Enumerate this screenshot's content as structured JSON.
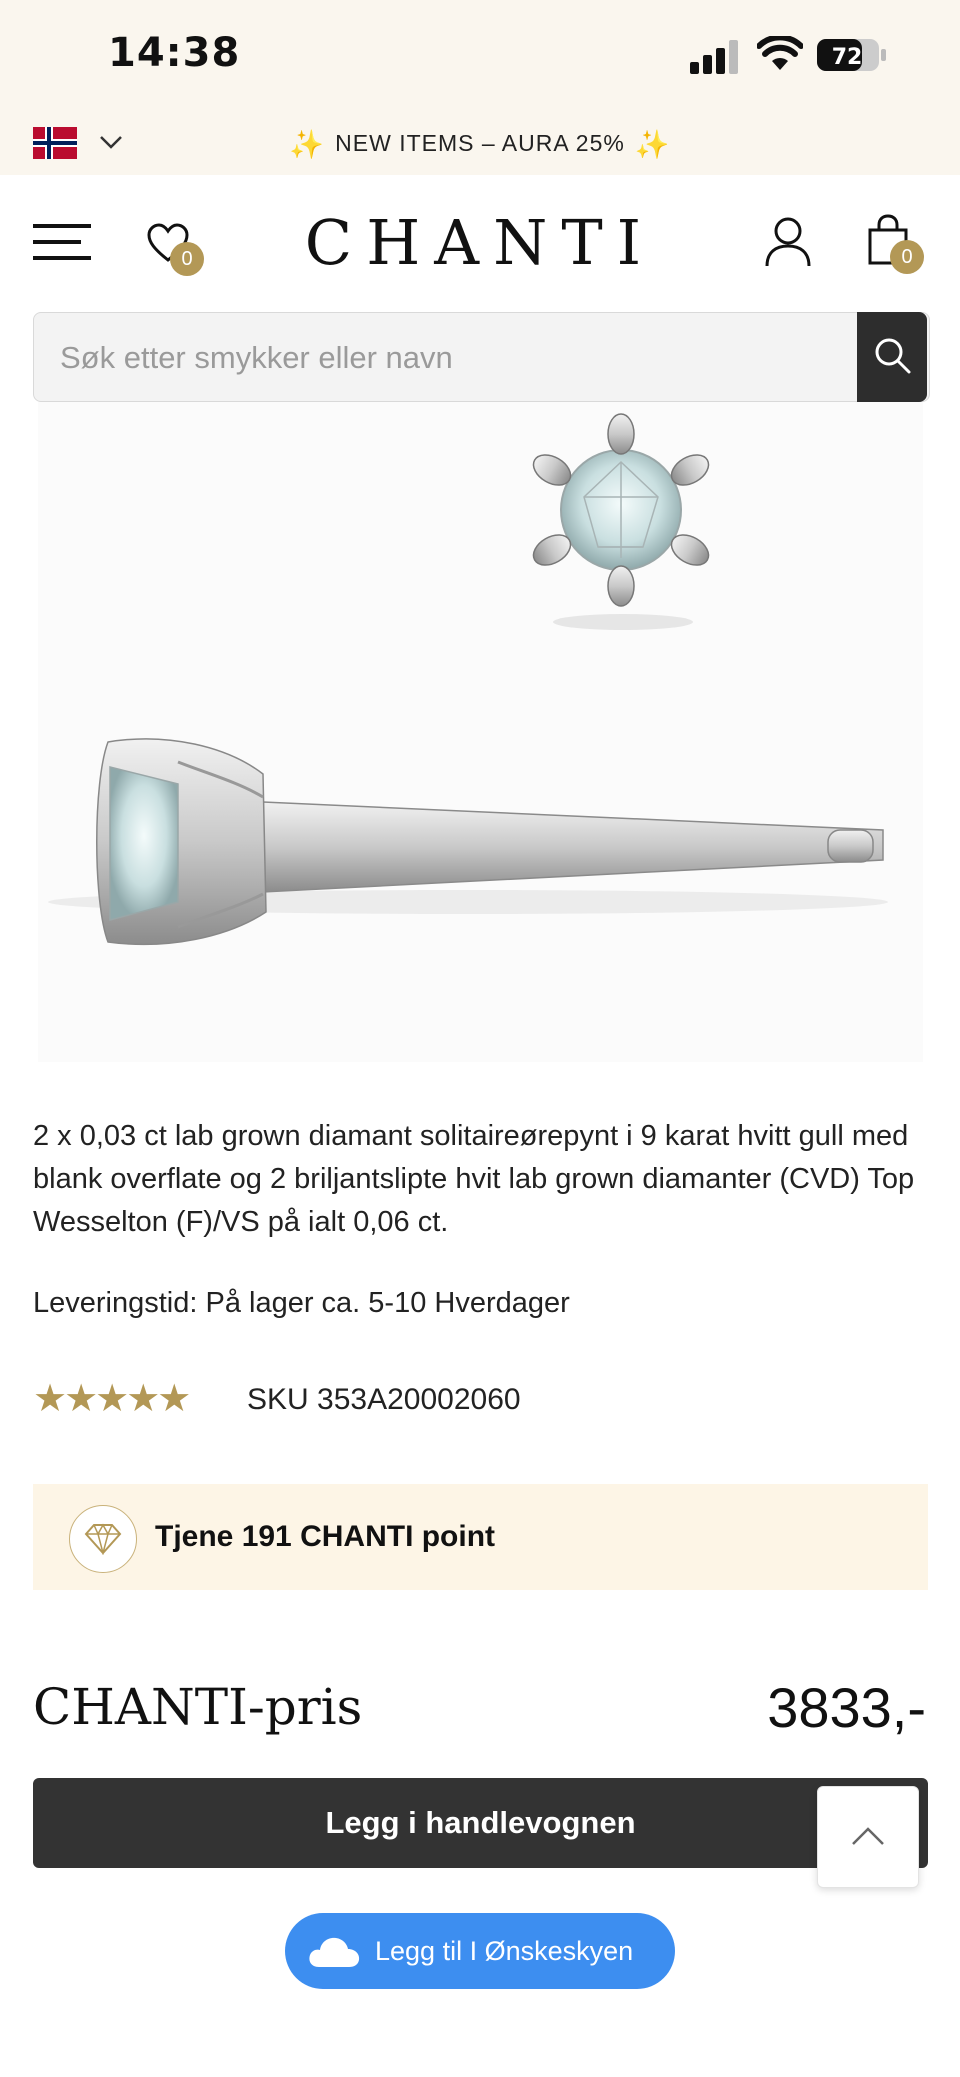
{
  "status_bar": {
    "time": "14:38",
    "battery": "72"
  },
  "promo_bar": {
    "text": "NEW ITEMS – AURA 25%"
  },
  "header": {
    "logo": "CHANTI",
    "wishlist_count": "0",
    "cart_count": "0"
  },
  "search": {
    "placeholder": "Søk etter smykker eller navn"
  },
  "product": {
    "description": "2 x 0,03 ct lab grown diamant solitaireørepynt i 9 karat hvitt gull med blank overflate og 2 briljantslipte hvit lab grown diamanter (CVD) Top Wesselton (F)/VS på ialt 0,06 ct.",
    "delivery": "Leveringstid: På lager ca. 5-10 Hverdager",
    "rating_stars": "★★★★★",
    "rating": 5,
    "sku": "SKU 353A20002060"
  },
  "points": {
    "text": "Tjene 191 CHANTI point"
  },
  "price": {
    "label": "CHANTI-pris",
    "value": "3833,-"
  },
  "actions": {
    "add_to_cart": "Legg i handlevognen",
    "wishlist_cloud": "Legg til I Ønskeskyen"
  },
  "colors": {
    "gold_accent": "#b39856",
    "dark_button": "#333333",
    "cream_bg": "#faf6ee",
    "points_bg": "#fdf5e6",
    "blue_button": "#3d8ef0"
  },
  "icons": [
    "norway-flag-icon",
    "chevron-down-icon",
    "sparkle-icon",
    "menu-icon",
    "heart-icon",
    "user-icon",
    "shopping-bag-icon",
    "search-icon",
    "diamond-icon",
    "arrow-up-icon",
    "cloud-icon"
  ]
}
